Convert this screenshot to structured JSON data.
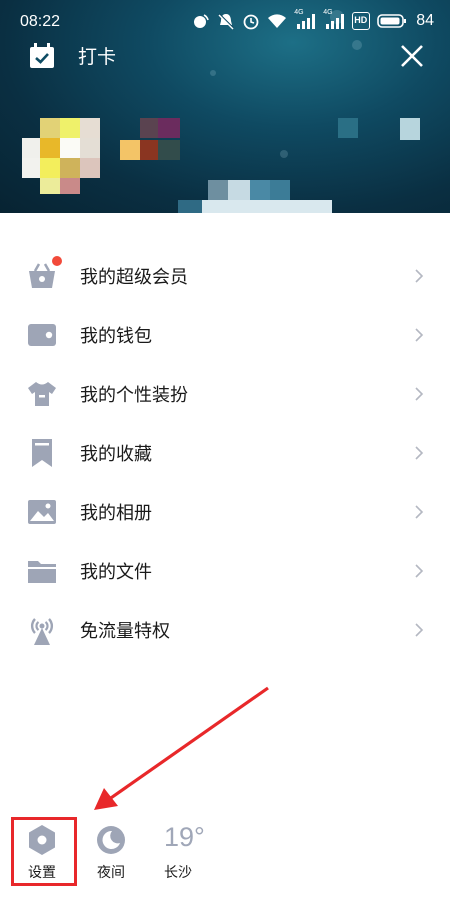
{
  "status_bar": {
    "time": "08:22",
    "signal_tag_1": "4G",
    "signal_tag_2": "4G",
    "hd_tag": "HD",
    "battery": "84"
  },
  "header": {
    "checkin_label": "打卡"
  },
  "menu": [
    {
      "label": "我的超级会员",
      "icon": "vip-basket-icon",
      "badge": true
    },
    {
      "label": "我的钱包",
      "icon": "wallet-icon"
    },
    {
      "label": "我的个性装扮",
      "icon": "tshirt-icon"
    },
    {
      "label": "我的收藏",
      "icon": "bookmark-icon"
    },
    {
      "label": "我的相册",
      "icon": "photo-icon"
    },
    {
      "label": "我的文件",
      "icon": "folder-icon"
    },
    {
      "label": "免流量特权",
      "icon": "antenna-icon"
    }
  ],
  "bottom": {
    "settings_label": "设置",
    "night_label": "夜间",
    "temperature": "19°",
    "city": "长沙"
  },
  "colors": {
    "icon_gray": "#9ea5b6",
    "annotation_red": "#e8282a",
    "badge_red": "#f24a3a"
  }
}
